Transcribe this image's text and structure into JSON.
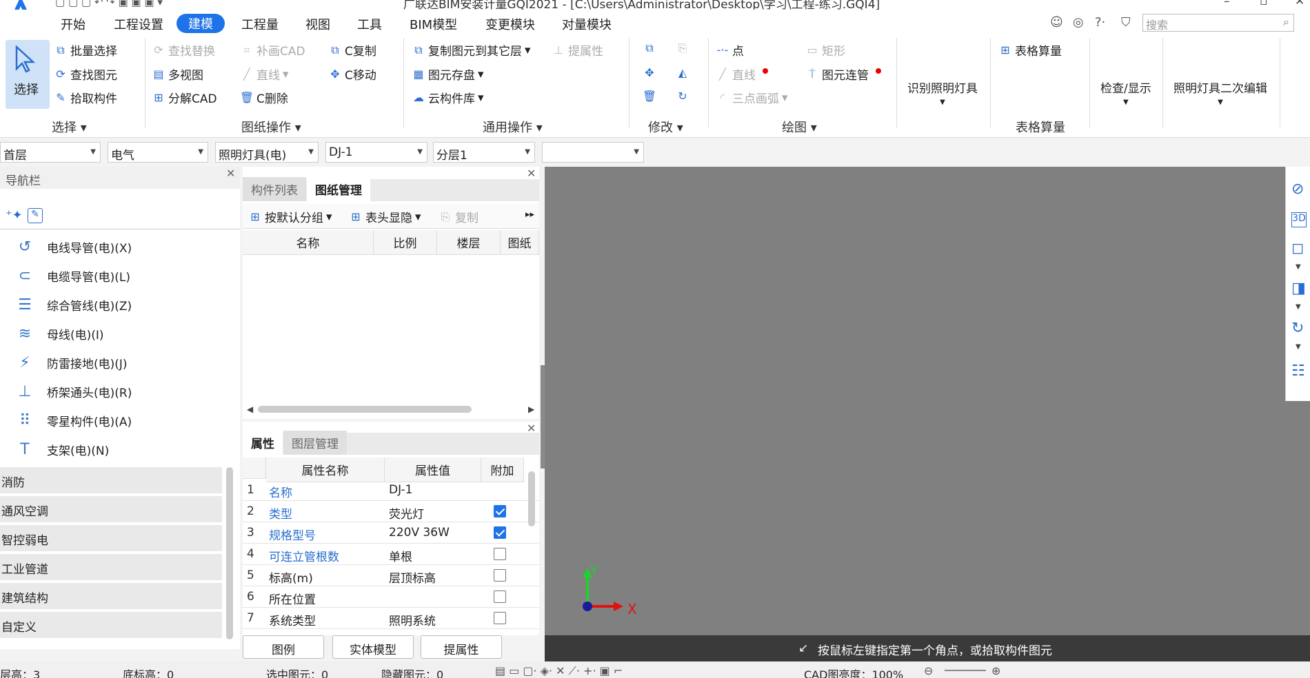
{
  "window": {
    "title": "广联达BIM安装计量GQI2021 - [C:\\Users\\Administrator\\Desktop\\学习\\工程-练习.GQI4]"
  },
  "menu": {
    "items": [
      "开始",
      "工程设置",
      "建模",
      "工程量",
      "视图",
      "工具",
      "BIM模型",
      "变更模块",
      "对量模块"
    ],
    "active": "建模",
    "search_placeholder": "搜索"
  },
  "ribbon": {
    "select": {
      "label": "选择",
      "items": [
        "批量选择",
        "查找图元",
        "拾取构件"
      ],
      "group": "选择"
    },
    "drawing_ops": {
      "items": [
        "查找替换",
        "多视图",
        "分解CAD",
        "补画CAD",
        "直线",
        "C删除",
        "C复制",
        "C移动"
      ],
      "group": "图纸操作"
    },
    "general_ops": {
      "items": [
        "复制图元到其它层",
        "图元存盘",
        "云构件库",
        "提属性"
      ],
      "group": "通用操作"
    },
    "modify": {
      "group": "修改"
    },
    "draw": {
      "items": [
        "点",
        "直线",
        "三点画弧",
        "矩形",
        "图元连管"
      ],
      "group": "绘图"
    },
    "identify": {
      "label": "识别照明灯具"
    },
    "table_calc": {
      "label": "表格算量",
      "group": "表格算量"
    },
    "check": {
      "label": "检查/显示"
    },
    "edit2": {
      "label": "照明灯具二次编辑"
    }
  },
  "combos": [
    "首层",
    "电气",
    "照明灯具(电)",
    "DJ-1",
    "分层1",
    ""
  ],
  "nav": {
    "title": "导航栏",
    "items": [
      "电线导管(电)(X)",
      "电缆导管(电)(L)",
      "综合管线(电)(Z)",
      "母线(电)(I)",
      "防雷接地(电)(J)",
      "桥架通头(电)(R)",
      "零星构件(电)(A)",
      "支架(电)(N)"
    ],
    "categories": [
      "消防",
      "通风空调",
      "智控弱电",
      "工业管道",
      "建筑结构",
      "自定义"
    ]
  },
  "drawing_panel": {
    "tabs": [
      "构件列表",
      "图纸管理"
    ],
    "active_tab": "图纸管理",
    "toolbar": [
      "按默认分组",
      "表头显隐",
      "复制"
    ],
    "columns": [
      "名称",
      "比例",
      "楼层",
      "图纸"
    ]
  },
  "property_panel": {
    "tabs": [
      "属性",
      "图层管理"
    ],
    "active_tab": "属性",
    "columns": [
      "属性名称",
      "属性值",
      "附加"
    ],
    "rows": [
      {
        "n": "1",
        "name": "名称",
        "value": "DJ-1",
        "blue": true,
        "check": null
      },
      {
        "n": "2",
        "name": "类型",
        "value": "荧光灯",
        "blue": true,
        "check": true
      },
      {
        "n": "3",
        "name": "规格型号",
        "value": "220V 36W",
        "blue": true,
        "check": true
      },
      {
        "n": "4",
        "name": "可连立管根数",
        "value": "单根",
        "blue": true,
        "check": false
      },
      {
        "n": "5",
        "name": "标高(m)",
        "value": "层顶标高",
        "blue": false,
        "check": false
      },
      {
        "n": "6",
        "name": "所在位置",
        "value": "",
        "blue": false,
        "check": false
      },
      {
        "n": "7",
        "name": "系统类型",
        "value": "照明系统",
        "blue": false,
        "check": false
      }
    ],
    "buttons": [
      "图例",
      "实体模型",
      "提属性"
    ]
  },
  "viewport": {
    "axis_y": "Y",
    "axis_x": "X",
    "hint": "按鼠标左键指定第一个角点，或拾取构件图元"
  },
  "status": {
    "layer_height": "层高：3",
    "floor_elev": "底标高：0",
    "selected": "选中图元：0",
    "hidden": "隐藏图元：0",
    "cad_brightness": "CAD图亮度：100%"
  },
  "colors": {
    "accent": "#1e73e8",
    "viewport": "#808080",
    "icon": "#2a6ed0"
  }
}
